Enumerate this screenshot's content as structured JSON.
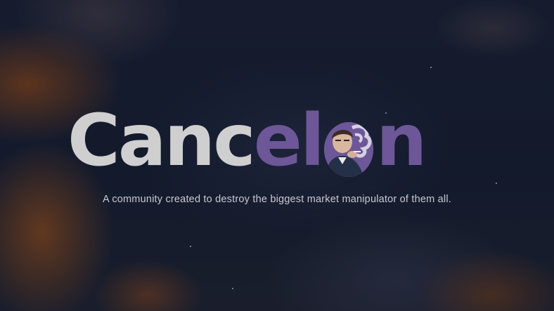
{
  "hero": {
    "logo": {
      "part_a": "Canc",
      "part_b": "el",
      "part_c": "n",
      "o_icon": "portrait-smoking-icon"
    },
    "tagline": "A community created to destroy the biggest market manipulator of them all."
  },
  "colors": {
    "logo_light": "#cfcfcf",
    "logo_accent": "#6d5798",
    "tagline": "#c9c9d3",
    "background": "#141a2b"
  }
}
